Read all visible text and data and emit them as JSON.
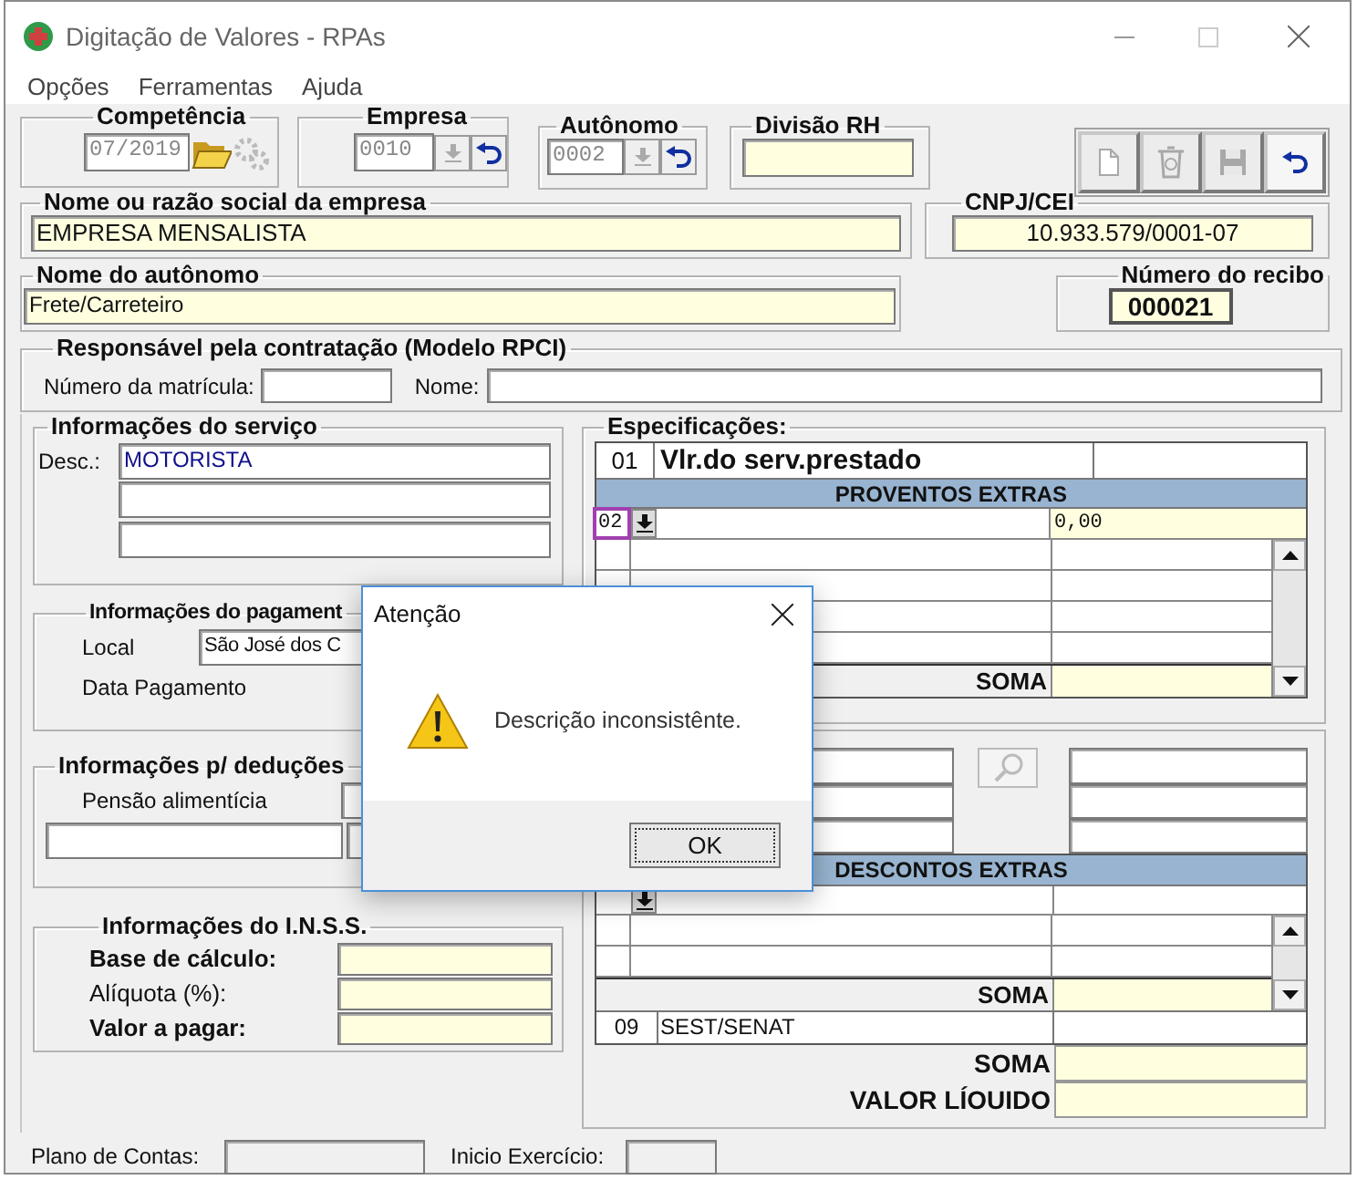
{
  "window": {
    "title": "Digitação de Valores - RPAs"
  },
  "menu": [
    "Opções",
    "Ferramentas",
    "Ajuda"
  ],
  "competencia": {
    "label": "Competência",
    "value": "07/2019"
  },
  "empresa": {
    "label": "Empresa",
    "value": "0010"
  },
  "autonomo": {
    "label": "Autônomo",
    "value": "0002"
  },
  "divisao_rh": {
    "label": "Divisão RH"
  },
  "toolbar": [
    {
      "kind": "new",
      "disabled": true
    },
    {
      "kind": "trash",
      "disabled": true
    },
    {
      "kind": "save",
      "disabled": true
    },
    {
      "kind": "undo",
      "disabled": false
    }
  ],
  "empresa_nome": {
    "label": "Nome ou razão social da empresa",
    "value": "EMPRESA MENSALISTA"
  },
  "cnpj": {
    "label": "CNPJ/CEI",
    "value": "10.933.579/0001-07"
  },
  "autonomo_nome": {
    "label": "Nome do autônomo",
    "value": "Frete/Carreteiro"
  },
  "recibo": {
    "label": "Número do recibo",
    "value": "000021"
  },
  "responsavel": {
    "title": "Responsável pela contratação (Modelo RPCI)",
    "matricula_label": "Número da matrícula:",
    "nome_label": "Nome:"
  },
  "servico": {
    "title": "Informações do serviço",
    "desc_label": "Desc.:",
    "desc_value": "MOTORISTA"
  },
  "pagamento": {
    "title": "Informações do pagament",
    "local_label": "Local",
    "local_value": "São José dos C",
    "data_label": "Data Pagamento"
  },
  "deducoes": {
    "title": "Informações p/ deduções",
    "pensao_label": "Pensão alimentícia"
  },
  "inss": {
    "title": "Informações do I.N.S.S.",
    "rows": [
      {
        "label": "Base de cálculo:",
        "bold": true
      },
      {
        "label": "Alíquota (%):",
        "bold": false
      },
      {
        "label": "Valor a pagar:",
        "bold": true
      }
    ]
  },
  "especificacoes": {
    "title": "Especificações:",
    "first": {
      "code": "01",
      "label": "Vlr.do serv.prestado"
    },
    "proventos_header": "PROVENTOS EXTRAS",
    "proventos_row": {
      "code": "02",
      "value": "0,00",
      "focused": true
    },
    "soma_label": "SOMA"
  },
  "descontos": {
    "header": "DESCONTOS EXTRAS",
    "soma_label": "SOMA",
    "sest": {
      "code": "09",
      "label": "SEST/SENAT"
    },
    "total_soma_label": "SOMA",
    "liquido_label": "VALOR LÍOUIDO"
  },
  "status_bar": {
    "plano_label": "Plano de Contas:",
    "inicio_label": "Inicio Exercício:"
  },
  "dialog": {
    "title": "Atenção",
    "message": "Descrição inconsistênte.",
    "button": "OK"
  }
}
